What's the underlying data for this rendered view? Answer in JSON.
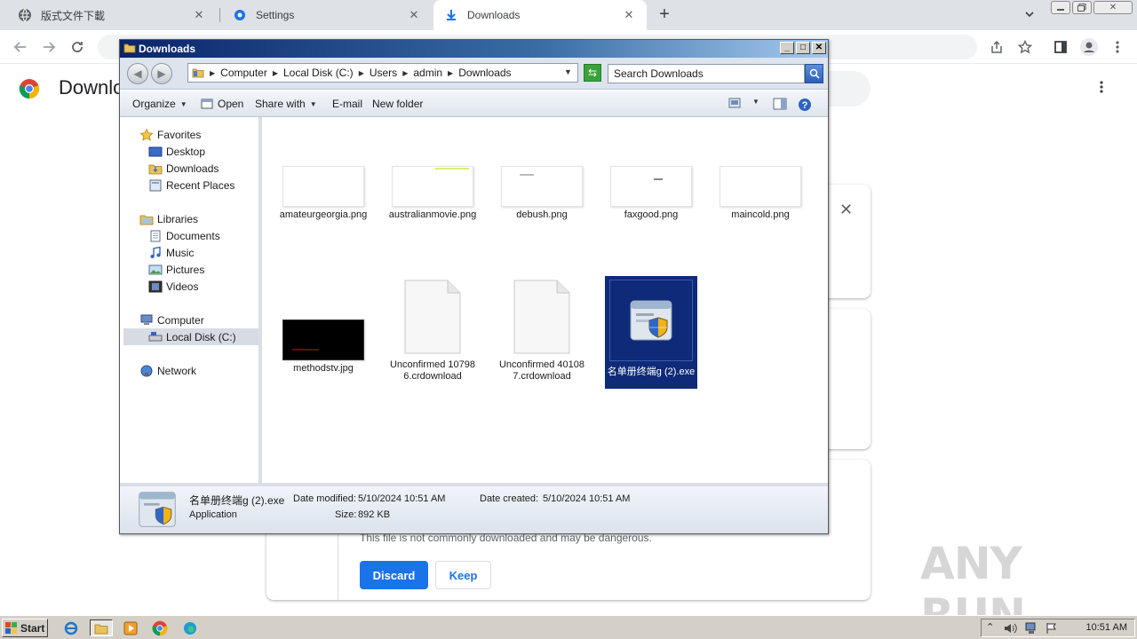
{
  "chrome": {
    "tabs": [
      {
        "label": "版式文件下載"
      },
      {
        "label": "Settings"
      },
      {
        "label": "Downloads"
      }
    ],
    "new_tab_label": "+",
    "page_title": "Downlo",
    "card": {
      "warning": "This file is not commonly downloaded and may be dangerous.",
      "discard_label": "Discard",
      "keep_label": "Keep"
    }
  },
  "explorer": {
    "title": "Downloads",
    "breadcrumb": [
      "Computer",
      "Local Disk (C:)",
      "Users",
      "admin",
      "Downloads"
    ],
    "search_placeholder": "Search Downloads",
    "commands": {
      "organize": "Organize",
      "open": "Open",
      "share_with": "Share with",
      "email": "E-mail",
      "new_folder": "New folder"
    },
    "nav": {
      "favorites": "Favorites",
      "desktop": "Desktop",
      "downloads": "Downloads",
      "recent_places": "Recent Places",
      "libraries": "Libraries",
      "documents": "Documents",
      "music": "Music",
      "pictures": "Pictures",
      "videos": "Videos",
      "computer": "Computer",
      "local_disk": "Local Disk (C:)",
      "network": "Network"
    },
    "files": [
      {
        "name": "amateurgeorgia.png"
      },
      {
        "name": "australianmovie.png"
      },
      {
        "name": "debush.png"
      },
      {
        "name": "faxgood.png"
      },
      {
        "name": "maincold.png"
      },
      {
        "name": "methodstv.jpg"
      },
      {
        "name": "Unconfirmed 107986.crdownload"
      },
      {
        "name": "Unconfirmed 401087.crdownload"
      },
      {
        "name": "名单册终端g (2).exe"
      }
    ],
    "status": {
      "file_name": "名单册终端g (2).exe",
      "file_type": "Application",
      "date_modified_label": "Date modified:",
      "date_modified": "5/10/2024 10:51 AM",
      "date_created_label": "Date created:",
      "date_created": "5/10/2024 10:51 AM",
      "size_label": "Size:",
      "size": "892 KB"
    }
  },
  "taskbar": {
    "start_label": "Start",
    "clock": "10:51 AM"
  },
  "watermark": "ANY RUN",
  "colors": {
    "accent": "#1a73e8",
    "selection": "#0f2a78",
    "title_bar": "#0a246a"
  }
}
